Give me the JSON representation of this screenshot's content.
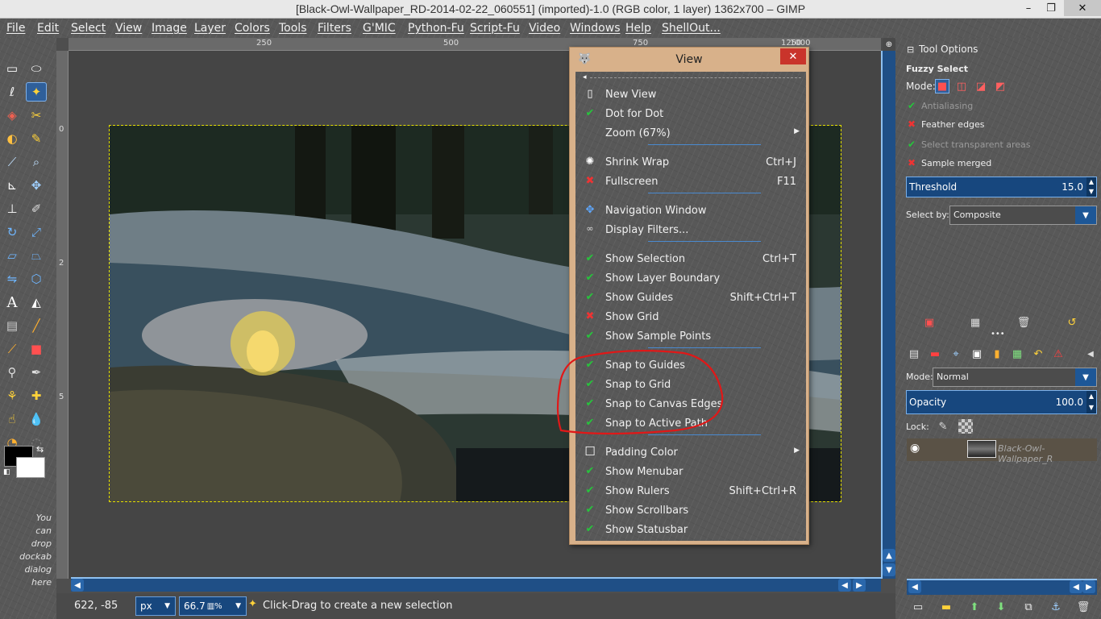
{
  "window": {
    "title": "[Black-Owl-Wallpaper_RD-2014-02-22_060551] (imported)-1.0 (RGB color, 1 layer) 1362x700 – GIMP",
    "min_glyph": "–",
    "max_glyph": "❐",
    "close_glyph": "✕"
  },
  "menubar": [
    "File",
    "Edit",
    "Select",
    "View",
    "Image",
    "Layer",
    "Colors",
    "Tools",
    "Filters",
    "G'MIC",
    "Python-Fu",
    "Script-Fu",
    "Video",
    "Windows",
    "Help",
    "ShellOut..."
  ],
  "toolbox": {
    "drop_hint": "You\ncan\ndrop\ndockab\ndialog\nhere",
    "tools": [
      "rect-select",
      "ellipse-select",
      "free-select",
      "fuzzy-select",
      "color-select",
      "scissors-select",
      "foreground-select",
      "paths",
      "color-picker",
      "zoom",
      "measure",
      "move",
      "align",
      "crop",
      "rotate",
      "scale",
      "shear",
      "perspective",
      "flip",
      "cage",
      "text",
      "bucket-fill",
      "blend",
      "pencil",
      "paintbrush",
      "eraser",
      "airbrush",
      "ink",
      "clone",
      "heal",
      "smudge",
      "dodge-burn",
      "convolve",
      "unified-transform"
    ]
  },
  "rulers": {
    "top": [
      "250",
      "500",
      "750",
      "1000",
      "1250"
    ],
    "left": [
      "0",
      "2",
      "5"
    ]
  },
  "statusbar": {
    "coords": "622, -85",
    "unit": "px",
    "zoom": "66.7",
    "message": "Click-Drag to create a new selection"
  },
  "tool_options": {
    "tab_title": "Tool Options",
    "tool_name": "Fuzzy Select",
    "mode_label": "Mode:",
    "options": [
      {
        "label": "Antialiasing",
        "state": "check",
        "faded": true
      },
      {
        "label": "Feather edges",
        "state": "cross",
        "faded": false
      },
      {
        "label": "Select transparent areas",
        "state": "check",
        "faded": true
      },
      {
        "label": "Sample merged",
        "state": "cross",
        "faded": false
      }
    ],
    "threshold_label": "Threshold",
    "threshold_value": "15.0",
    "select_by_label": "Select by:",
    "select_by_value": "Composite"
  },
  "layers": {
    "mode_label": "Mode:",
    "mode_value": "Normal",
    "opacity_label": "Opacity",
    "opacity_value": "100.0",
    "lock_label": "Lock:",
    "layer_name": "Black-Owl-Wallpaper_R"
  },
  "view_menu": {
    "title": "View",
    "items": [
      {
        "label": "New View",
        "icon": "page",
        "accel": "",
        "submenu": false
      },
      {
        "label": "Dot for Dot",
        "icon": "check",
        "accel": "",
        "submenu": false
      },
      {
        "label": "Zoom (67%)",
        "icon": "none",
        "accel": "",
        "submenu": true
      },
      {
        "label": "Shrink Wrap",
        "icon": "shrink",
        "accel": "Ctrl+J",
        "submenu": false
      },
      {
        "label": "Fullscreen",
        "icon": "cross",
        "accel": "F11",
        "submenu": false
      },
      {
        "label": "Navigation Window",
        "icon": "navigation",
        "accel": "",
        "submenu": false
      },
      {
        "label": "Display Filters...",
        "icon": "glasses",
        "accel": "",
        "submenu": false
      },
      {
        "label": "Show Selection",
        "icon": "check",
        "accel": "Ctrl+T",
        "submenu": false
      },
      {
        "label": "Show Layer Boundary",
        "icon": "check",
        "accel": "",
        "submenu": false
      },
      {
        "label": "Show Guides",
        "icon": "check",
        "accel": "Shift+Ctrl+T",
        "submenu": false
      },
      {
        "label": "Show Grid",
        "icon": "cross",
        "accel": "",
        "submenu": false
      },
      {
        "label": "Show Sample Points",
        "icon": "check",
        "accel": "",
        "submenu": false
      },
      {
        "label": "Snap to Guides",
        "icon": "check",
        "accel": "",
        "submenu": false
      },
      {
        "label": "Snap to Grid",
        "icon": "check",
        "accel": "",
        "submenu": false
      },
      {
        "label": "Snap to Canvas Edges",
        "icon": "check",
        "accel": "",
        "submenu": false
      },
      {
        "label": "Snap to Active Path",
        "icon": "check",
        "accel": "",
        "submenu": false
      },
      {
        "label": "Padding Color",
        "icon": "box",
        "accel": "",
        "submenu": true
      },
      {
        "label": "Show Menubar",
        "icon": "check",
        "accel": "",
        "submenu": false
      },
      {
        "label": "Show Rulers",
        "icon": "check",
        "accel": "Shift+Ctrl+R",
        "submenu": false
      },
      {
        "label": "Show Scrollbars",
        "icon": "check",
        "accel": "",
        "submenu": false
      },
      {
        "label": "Show Statusbar",
        "icon": "check",
        "accel": "",
        "submenu": false
      }
    ]
  },
  "colors": {
    "accent_blue": "#17477e",
    "check_green": "#27c43c",
    "cross_red": "#e33333",
    "annotation_red": "#e01818",
    "selection_yellow": "#e6e000",
    "menu_frame": "#d8b18a"
  }
}
